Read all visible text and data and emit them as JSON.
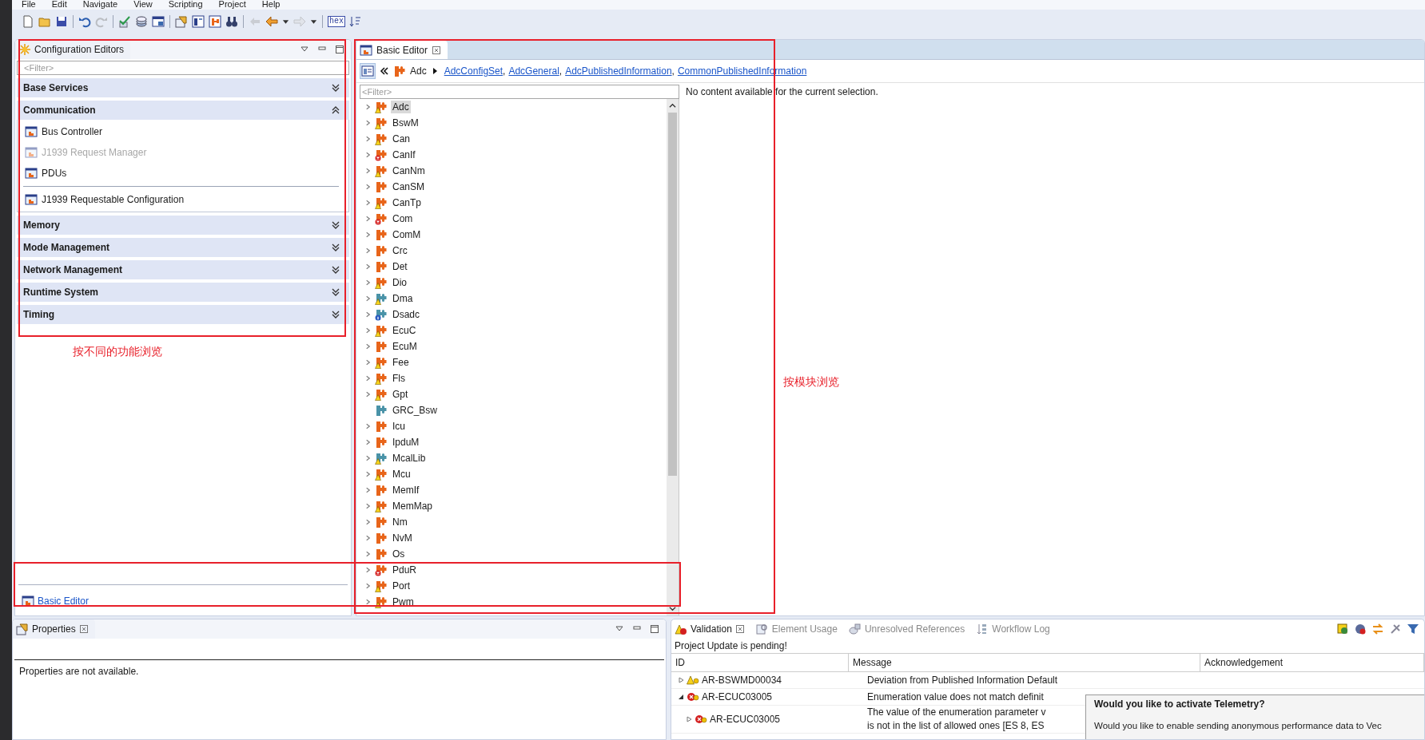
{
  "menu": [
    "File",
    "Edit",
    "Navigate",
    "View",
    "Scripting",
    "Project",
    "Help"
  ],
  "toolbar": [
    [
      {
        "kind": "new",
        "disabled": false
      },
      {
        "kind": "open",
        "disabled": false
      },
      {
        "kind": "save",
        "disabled": false
      }
    ],
    [
      {
        "kind": "undo",
        "disabled": false
      },
      {
        "kind": "redo",
        "disabled": true
      }
    ],
    [
      {
        "kind": "validate",
        "disabled": false
      },
      {
        "kind": "stack",
        "disabled": false
      },
      {
        "kind": "window",
        "disabled": false
      }
    ],
    [
      {
        "kind": "properties",
        "disabled": false
      },
      {
        "kind": "editor",
        "disabled": false
      },
      {
        "kind": "module",
        "disabled": false
      },
      {
        "kind": "find",
        "disabled": false
      }
    ],
    [
      {
        "kind": "pin",
        "disabled": true
      },
      {
        "kind": "back",
        "disabled": false
      },
      {
        "kind": "dropdown",
        "disabled": false
      },
      {
        "kind": "forward",
        "disabled": true
      },
      {
        "kind": "dropdown",
        "disabled": false
      }
    ],
    [
      {
        "kind": "hex",
        "label": "hex",
        "disabled": false
      },
      {
        "kind": "sort",
        "disabled": false
      }
    ]
  ],
  "config_panel": {
    "title": "Configuration Editors",
    "filter_placeholder": "<Filter>",
    "sections": [
      {
        "label": "Base Services",
        "expanded": false
      },
      {
        "label": "Communication",
        "expanded": true,
        "groups": [
          [
            {
              "label": "Bus Controller",
              "disabled": false
            },
            {
              "label": "J1939 Request Manager",
              "disabled": true
            },
            {
              "label": "PDUs",
              "disabled": false
            }
          ],
          [
            {
              "label": "J1939 Requestable Configuration",
              "disabled": false
            }
          ]
        ]
      },
      {
        "label": "Memory",
        "expanded": false
      },
      {
        "label": "Mode Management",
        "expanded": false
      },
      {
        "label": "Network Management",
        "expanded": false
      },
      {
        "label": "Runtime System",
        "expanded": false
      },
      {
        "label": "Timing",
        "expanded": false
      }
    ],
    "annotation": "按不同的功能浏览",
    "footer_link": "Basic Editor"
  },
  "editor": {
    "tab": "Basic Editor",
    "breadcrumb": {
      "current": "Adc",
      "links": [
        "AdcConfigSet",
        "AdcGeneral",
        "AdcPublishedInformation",
        "CommonPublishedInformation"
      ],
      "separator": ","
    },
    "filter_placeholder": "<Filter>",
    "tree": [
      {
        "label": "Adc",
        "color": "#e8651a",
        "kind": "warning",
        "expandable": true,
        "selected": true
      },
      {
        "label": "BswM",
        "color": "#e8651a",
        "kind": "warning",
        "expandable": true,
        "selected": false
      },
      {
        "label": "Can",
        "color": "#e8651a",
        "kind": "warning",
        "expandable": true,
        "selected": false
      },
      {
        "label": "CanIf",
        "color": "#e8651a",
        "kind": "error",
        "expandable": true,
        "selected": false
      },
      {
        "label": "CanNm",
        "color": "#e8651a",
        "kind": "warning",
        "expandable": true,
        "selected": false
      },
      {
        "label": "CanSM",
        "color": "#e8651a",
        "kind": "plain",
        "expandable": true,
        "selected": false
      },
      {
        "label": "CanTp",
        "color": "#e8651a",
        "kind": "warning",
        "expandable": true,
        "selected": false
      },
      {
        "label": "Com",
        "color": "#e8651a",
        "kind": "error",
        "expandable": true,
        "selected": false
      },
      {
        "label": "ComM",
        "color": "#e8651a",
        "kind": "plain",
        "expandable": true,
        "selected": false
      },
      {
        "label": "Crc",
        "color": "#e8651a",
        "kind": "plain",
        "expandable": true,
        "selected": false
      },
      {
        "label": "Det",
        "color": "#e8651a",
        "kind": "plain",
        "expandable": true,
        "selected": false
      },
      {
        "label": "Dio",
        "color": "#e8651a",
        "kind": "warning",
        "expandable": true,
        "selected": false
      },
      {
        "label": "Dma",
        "color": "#4a93a8",
        "kind": "warning",
        "expandable": true,
        "selected": false
      },
      {
        "label": "Dsadc",
        "color": "#4a93a8",
        "kind": "info",
        "expandable": true,
        "selected": false
      },
      {
        "label": "EcuC",
        "color": "#e8651a",
        "kind": "warning",
        "expandable": true,
        "selected": false
      },
      {
        "label": "EcuM",
        "color": "#e8651a",
        "kind": "plain",
        "expandable": true,
        "selected": false
      },
      {
        "label": "Fee",
        "color": "#e8651a",
        "kind": "warning",
        "expandable": true,
        "selected": false
      },
      {
        "label": "Fls",
        "color": "#e8651a",
        "kind": "warning",
        "expandable": true,
        "selected": false
      },
      {
        "label": "Gpt",
        "color": "#e8651a",
        "kind": "warning",
        "expandable": true,
        "selected": false
      },
      {
        "label": "GRC_Bsw",
        "color": "#4a93a8",
        "kind": "plain",
        "expandable": false,
        "selected": false
      },
      {
        "label": "Icu",
        "color": "#e8651a",
        "kind": "plain",
        "expandable": true,
        "selected": false
      },
      {
        "label": "IpduM",
        "color": "#e8651a",
        "kind": "plain",
        "expandable": true,
        "selected": false
      },
      {
        "label": "McalLib",
        "color": "#4a93a8",
        "kind": "warning",
        "expandable": true,
        "selected": false
      },
      {
        "label": "Mcu",
        "color": "#e8651a",
        "kind": "warning",
        "expandable": true,
        "selected": false
      },
      {
        "label": "MemIf",
        "color": "#e8651a",
        "kind": "plain",
        "expandable": true,
        "selected": false
      },
      {
        "label": "MemMap",
        "color": "#e8651a",
        "kind": "warning",
        "expandable": true,
        "selected": false
      },
      {
        "label": "Nm",
        "color": "#e8651a",
        "kind": "plain",
        "expandable": true,
        "selected": false
      },
      {
        "label": "NvM",
        "color": "#e8651a",
        "kind": "plain",
        "expandable": true,
        "selected": false
      },
      {
        "label": "Os",
        "color": "#e8651a",
        "kind": "plain",
        "expandable": true,
        "selected": false
      },
      {
        "label": "PduR",
        "color": "#e8651a",
        "kind": "error",
        "expandable": true,
        "selected": false
      },
      {
        "label": "Port",
        "color": "#e8651a",
        "kind": "warning",
        "expandable": true,
        "selected": false
      },
      {
        "label": "Pwm",
        "color": "#e8651a",
        "kind": "warning",
        "expandable": true,
        "selected": false
      }
    ],
    "detail_message": "No content available for the current selection.",
    "annotation": "按模块浏览"
  },
  "properties": {
    "tab": "Properties",
    "message": "Properties are not available."
  },
  "validation": {
    "tabs": [
      {
        "label": "Validation",
        "selected": true
      },
      {
        "label": "Element Usage",
        "selected": false
      },
      {
        "label": "Unresolved References",
        "selected": false
      },
      {
        "label": "Workflow Log",
        "selected": false
      }
    ],
    "status": "Project Update is pending!",
    "columns": [
      "ID",
      "Message",
      "Acknowledgement"
    ],
    "rows": [
      {
        "id": "AR-BSWMD00034",
        "kind": "warning",
        "expanded": false,
        "message": [
          "Deviation from Published Information Default"
        ]
      },
      {
        "id": "AR-ECUC03005",
        "kind": "error",
        "expanded": true,
        "message": [
          "Enumeration value does not match definit"
        ],
        "children": [
          {
            "id": "AR-ECUC03005",
            "kind": "error",
            "expanded": false,
            "message": [
              "The value of the enumeration parameter v",
              "is not in the list of allowed ones [ES 8, ES"
            ]
          }
        ]
      }
    ]
  },
  "dialog": {
    "title": "Would you like to activate Telemetry?",
    "message": "Would you like to enable sending anonymous performance data to Vec"
  }
}
